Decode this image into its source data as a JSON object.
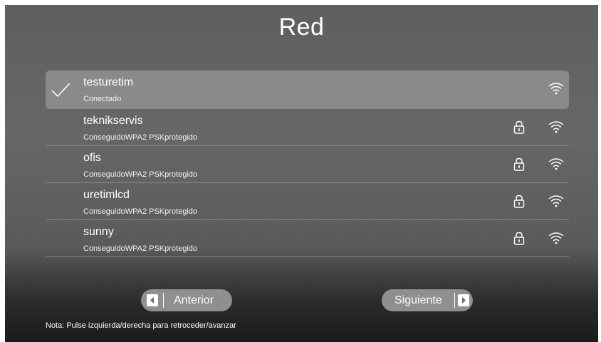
{
  "screen": {
    "title": "Red",
    "networks": [
      {
        "ssid": "testuretim",
        "status": "Conectado",
        "connected": true,
        "secured": false,
        "signal_icon": "wifi-icon"
      },
      {
        "ssid": "teknikservis",
        "status": "ConseguidoWPA2 PSKprotegido",
        "connected": false,
        "secured": true,
        "signal_icon": "wifi-icon"
      },
      {
        "ssid": "ofis",
        "status": "ConseguidoWPA2 PSKprotegido",
        "connected": false,
        "secured": true,
        "signal_icon": "wifi-icon"
      },
      {
        "ssid": "uretimlcd",
        "status": "ConseguidoWPA2 PSKprotegido",
        "connected": false,
        "secured": true,
        "signal_icon": "wifi-icon"
      },
      {
        "ssid": "sunny",
        "status": "ConseguidoWPA2 PSKprotegido",
        "connected": false,
        "secured": true,
        "signal_icon": "wifi-icon"
      }
    ],
    "prev_button": {
      "label": "Anterior",
      "icon": "arrow-left-icon"
    },
    "next_button": {
      "label": "Siguiente",
      "icon": "arrow-right-icon"
    },
    "note": "Nota: Pulse izquierda/derecha para retroceder/avanzar"
  },
  "colors": {
    "background": "#616161",
    "selected_row": "#8a8a8a",
    "button": "#8f8f8f",
    "text": "#ffffff"
  }
}
